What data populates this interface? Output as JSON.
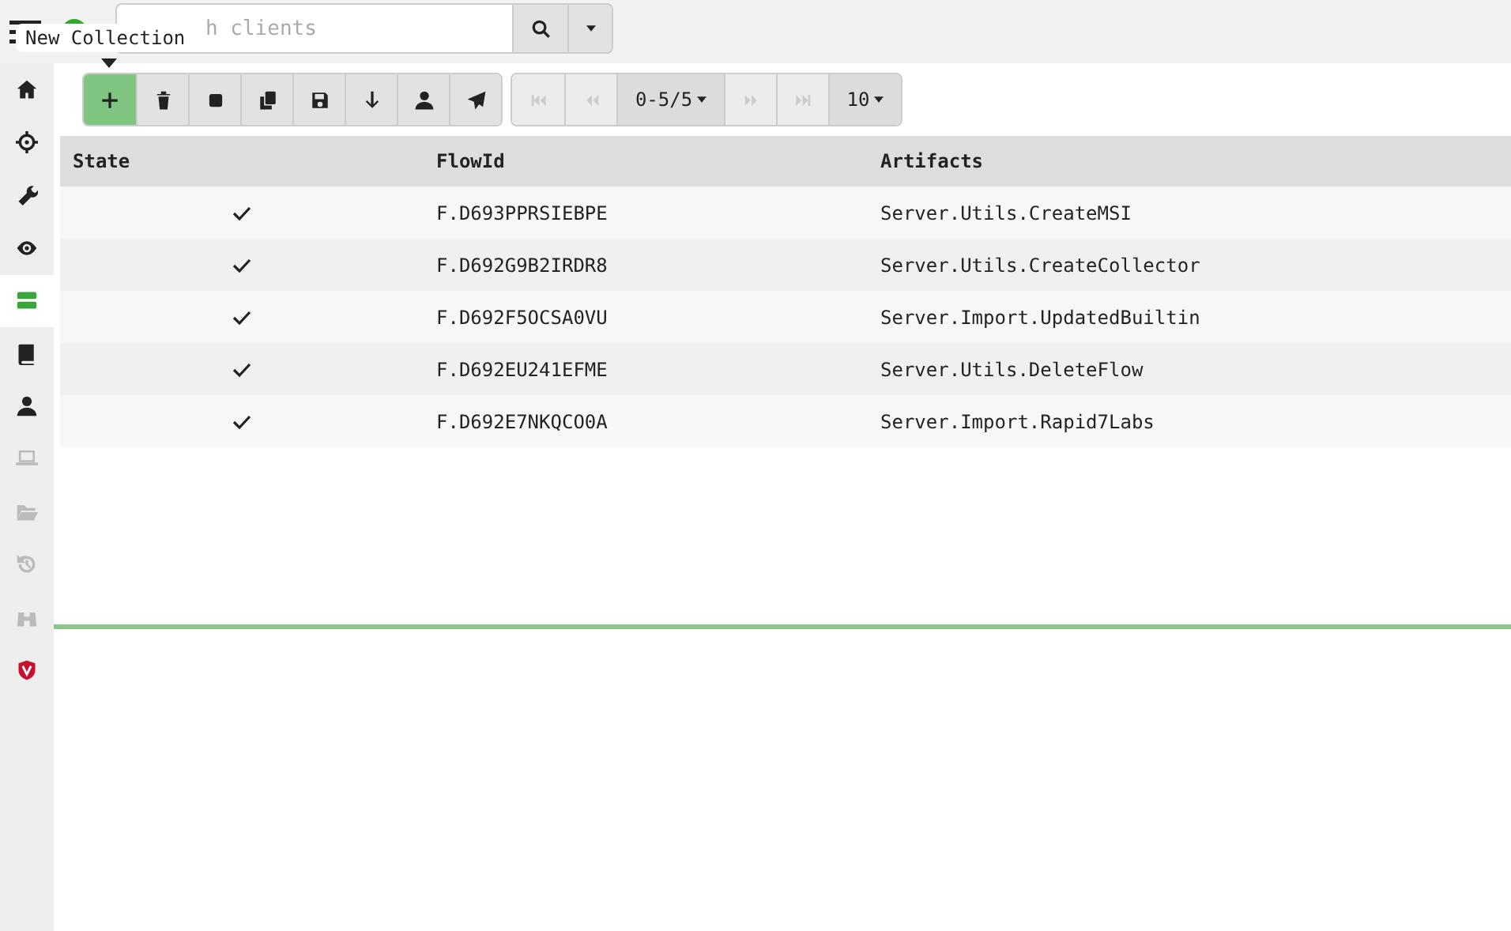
{
  "search": {
    "placeholder": "h clients"
  },
  "tooltip": {
    "text": "New Collection"
  },
  "sidebar": {
    "items": [
      {
        "selected": false,
        "disabled": false
      },
      {
        "selected": false,
        "disabled": false
      },
      {
        "selected": false,
        "disabled": false
      },
      {
        "selected": false,
        "disabled": false
      },
      {
        "selected": true,
        "disabled": false
      },
      {
        "selected": false,
        "disabled": false
      },
      {
        "selected": false,
        "disabled": false
      },
      {
        "selected": false,
        "disabled": true
      },
      {
        "selected": false,
        "disabled": true
      },
      {
        "selected": false,
        "disabled": true
      },
      {
        "selected": false,
        "disabled": true
      },
      {
        "selected": false,
        "disabled": false
      }
    ]
  },
  "toolbar": [
    {
      "selected": true
    },
    {
      "selected": false
    },
    {
      "selected": false
    },
    {
      "selected": false
    },
    {
      "selected": false
    },
    {
      "selected": false
    },
    {
      "selected": false
    },
    {
      "selected": false
    }
  ],
  "pager": {
    "range": "0-5/5",
    "page_size": "10",
    "first_disabled": true,
    "prev_disabled": true,
    "next_disabled": true,
    "last_disabled": true
  },
  "table": {
    "columns": [
      "State",
      "FlowId",
      "Artifacts"
    ],
    "rows": [
      {
        "done": true,
        "flow_id": "F.D693PPRSIEBPE",
        "artifacts": "Server.Utils.CreateMSI"
      },
      {
        "done": true,
        "flow_id": "F.D692G9B2IRDR8",
        "artifacts": "Server.Utils.CreateCollector"
      },
      {
        "done": true,
        "flow_id": "F.D692F5OCSA0VU",
        "artifacts": "Server.Import.UpdatedBuiltin"
      },
      {
        "done": true,
        "flow_id": "F.D692EU241EFME",
        "artifacts": "Server.Utils.DeleteFlow"
      },
      {
        "done": true,
        "flow_id": "F.D692E7NKQCO0A",
        "artifacts": "Server.Import.Rapid7Labs"
      }
    ]
  }
}
